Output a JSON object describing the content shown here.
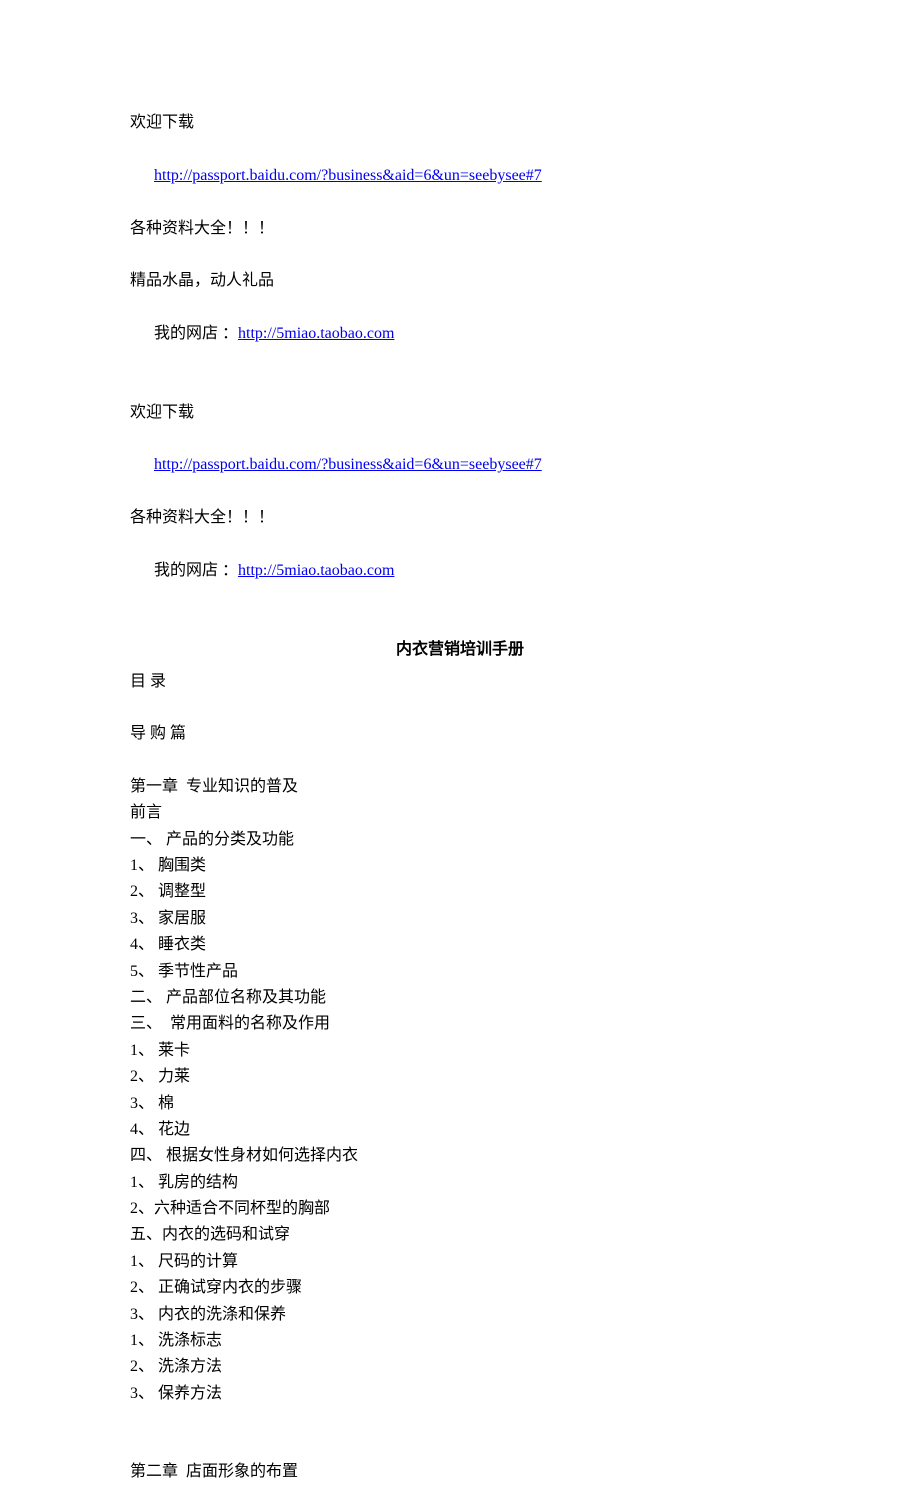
{
  "header1": {
    "welcome": "欢迎下载",
    "link1_text": "http://passport.baidu.com/?business&aid=6&un=seebysee#7",
    "materials": "各种资料大全！！！"
  },
  "header2": {
    "crystal": "精品水晶，动人礼品",
    "shop_prefix": "我的网店 ：",
    "shop_link": "http://5miao.taobao.com"
  },
  "header3": {
    "welcome": "欢迎下载",
    "link1_text": "http://passport.baidu.com/?business&aid=6&un=seebysee#7",
    "materials": "各种资料大全！！！",
    "shop_prefix": "我的网店 ：",
    "shop_link": "http://5miao.taobao.com"
  },
  "title": "内衣营销培训手册",
  "toc_label": "目 录",
  "guide_label": "导 购 篇",
  "chapter1_title": "第一章  专业知识的普及",
  "chapter1_lines": [
    "前言",
    "一、 产品的分类及功能",
    "1、 胸围类",
    "2、 调整型",
    "3、 家居服",
    "4、 睡衣类",
    "5、 季节性产品",
    "二、 产品部位名称及其功能",
    "三、  常用面料的名称及作用",
    "1、 莱卡",
    "2、 力莱",
    "3、 棉",
    "4、 花边",
    "四、 根据女性身材如何选择内衣",
    "1、 乳房的结构",
    "2、六种适合不同杯型的胸部",
    "五、内衣的选码和试穿",
    "1、 尺码的计算",
    "2、 正确试穿内衣的步骤",
    "3、 内衣的洗涤和保养",
    "1、 洗涤标志",
    "2、 洗涤方法",
    "3、 保养方法"
  ],
  "chapter2_title": "第二章  店面形象的布置"
}
